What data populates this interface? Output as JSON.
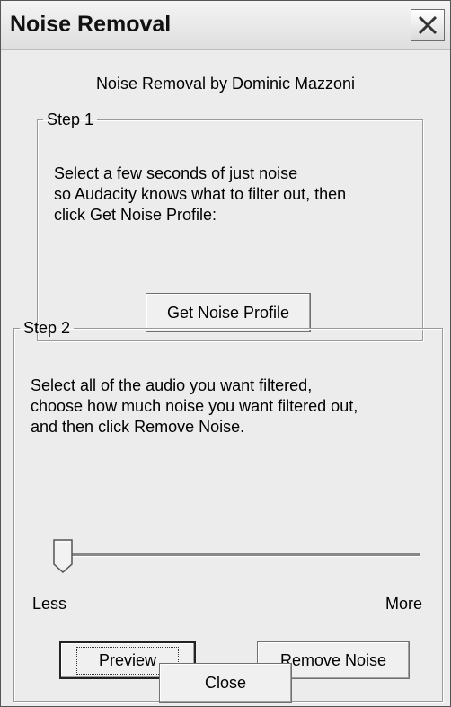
{
  "window": {
    "title": "Noise Removal",
    "close_icon": "close-icon"
  },
  "byline": "Noise Removal by Dominic Mazzoni",
  "step1": {
    "legend": "Step 1",
    "lines": [
      "Select a few seconds of just noise",
      "so Audacity knows what to filter out, then",
      "click Get Noise Profile:"
    ],
    "button_label": "Get Noise Profile"
  },
  "step2": {
    "legend": "Step 2",
    "lines": [
      "Select all of the audio you want filtered,",
      "choose how much noise you want filtered out,",
      "and then click Remove Noise."
    ],
    "slider": {
      "min_label": "Less",
      "max_label": "More",
      "value_fraction": 0.0
    },
    "preview_label": "Preview",
    "remove_label": "Remove Noise"
  },
  "close_label": "Close",
  "colors": {
    "dialog_bg": "#ececec",
    "border": "#9a9a9a",
    "button_face": "#f0f0f0"
  }
}
